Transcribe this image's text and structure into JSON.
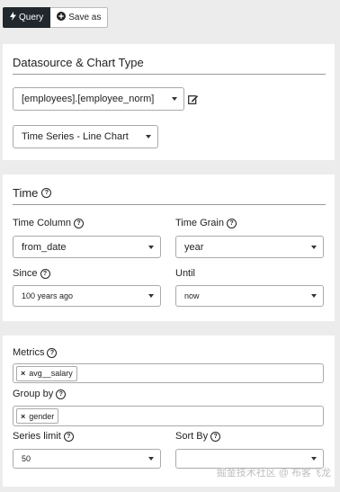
{
  "toolbar": {
    "query_label": "Query",
    "save_label": "Save as"
  },
  "datasource_panel": {
    "title": "Datasource & Chart Type",
    "datasource_value": "[employees].[employee_norm]",
    "chart_type_value": "Time Series - Line Chart"
  },
  "time_panel": {
    "title": "Time",
    "time_column_label": "Time Column",
    "time_column_value": "from_date",
    "time_grain_label": "Time Grain",
    "time_grain_value": "year",
    "since_label": "Since",
    "since_value": "100 years ago",
    "until_label": "Until",
    "until_value": "now"
  },
  "query_panel": {
    "metrics_label": "Metrics",
    "metrics": [
      "avg__salary"
    ],
    "group_by_label": "Group by",
    "group_by": [
      "gender"
    ],
    "series_limit_label": "Series limit",
    "series_limit_value": "50",
    "sort_by_label": "Sort By",
    "sort_by_value": ""
  },
  "icons": {
    "query": "bolt-icon",
    "save": "plus-circle-icon",
    "edit": "edit-icon",
    "help": "question-circle-icon",
    "caret": "caret-down-icon",
    "remove": "x-icon"
  },
  "watermark": "掘金技术社区 @ 布客飞龙"
}
